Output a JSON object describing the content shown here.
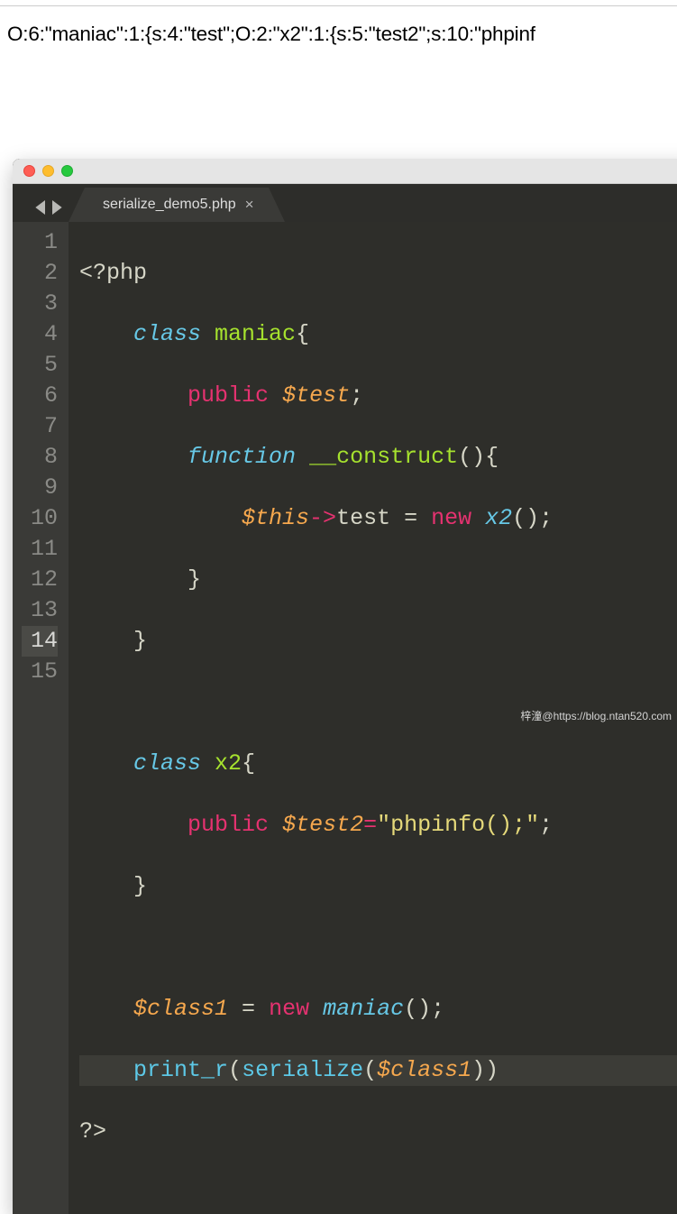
{
  "output": {
    "text": "O:6:\"maniac\":1:{s:4:\"test\";O:2:\"x2\":1:{s:5:\"test2\";s:10:\"phpinf"
  },
  "window": {
    "tab_name": "serialize_demo5.php",
    "tab_close": "×"
  },
  "code": {
    "lines": [
      {
        "n": "1"
      },
      {
        "n": "2"
      },
      {
        "n": "3"
      },
      {
        "n": "4"
      },
      {
        "n": "5"
      },
      {
        "n": "6"
      },
      {
        "n": "7"
      },
      {
        "n": "8"
      },
      {
        "n": "9"
      },
      {
        "n": "10"
      },
      {
        "n": "11"
      },
      {
        "n": "12"
      },
      {
        "n": "13"
      },
      {
        "n": "14"
      },
      {
        "n": "15"
      }
    ],
    "t": {
      "l1_open": "<?php",
      "l2_class": "class",
      "l2_name": "maniac",
      "l2_brace": "{",
      "l3_public": "public",
      "l3_var": "$test",
      "l3_semi": ";",
      "l4_func": "function",
      "l4_name": "__construct",
      "l4_parens": "(){",
      "l5_this": "$this",
      "l5_arrow": "->",
      "l5_prop": "test",
      "l5_eq": " = ",
      "l5_new": "new",
      "l5_x2": "x2",
      "l5_call": "();",
      "l6_brace": "}",
      "l7_brace": "}",
      "l9_class": "class",
      "l9_name": "x2",
      "l9_brace": "{",
      "l10_public": "public",
      "l10_var": "$test2",
      "l10_eq": "=",
      "l10_str": "\"phpinfo();\"",
      "l10_semi": ";",
      "l11_brace": "}",
      "l13_var": "$class1",
      "l13_eq": " = ",
      "l13_new": "new",
      "l13_maniac": "maniac",
      "l13_call": "();",
      "l14_print": "print_r",
      "l14_open": "(",
      "l14_ser": "serialize",
      "l14_open2": "(",
      "l14_var": "$class1",
      "l14_close": "))",
      "l15_close": "?>"
    }
  },
  "watermark": "梓潼@https://blog.ntan520.com"
}
